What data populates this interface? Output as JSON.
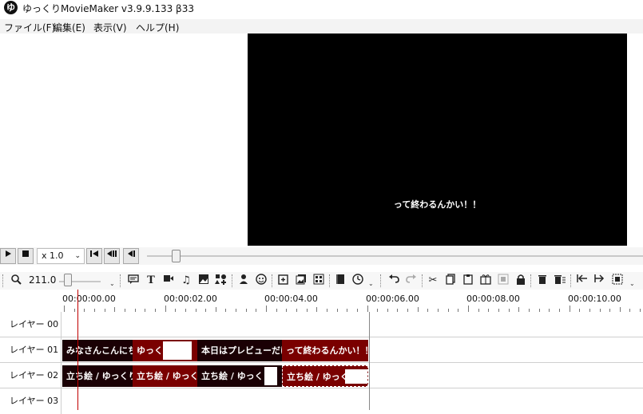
{
  "titlebar": {
    "icon_glyph": "ゆ",
    "title": "ゆっくりMovieMaker v3.9.9.133 β33"
  },
  "menu": [
    {
      "label": "ファイル(F)"
    },
    {
      "label": "編集(E)"
    },
    {
      "label": "表示(V)"
    },
    {
      "label": "ヘルプ(H)"
    }
  ],
  "preview": {
    "subtitle": "って終わるんかい！！"
  },
  "playback": {
    "speed": "x 1.0"
  },
  "timeline": {
    "zoom": "211.0",
    "ruler_labels": [
      "00:00:00.00",
      "00:00:02.00",
      "00:00:04.00",
      "00:00:06.00",
      "00:00:08.00",
      "00:00:10.00"
    ],
    "layers": [
      {
        "label": "レイヤー 00",
        "clips": []
      },
      {
        "label": "レイヤー 01",
        "clips": [
          {
            "text": "みなさんこんにち"
          },
          {
            "text": "ゆっくり"
          },
          {
            "text": "本日はプレビューだけ"
          },
          {
            "text": "って終わるんかい！！"
          }
        ]
      },
      {
        "label": "レイヤー 02",
        "clips": [
          {
            "text": "立ち絵 / ゆっくり"
          },
          {
            "text": "立ち絵 / ゆっく"
          },
          {
            "text": "立ち絵 / ゆっくり"
          },
          {
            "text": "立ち絵 / ゆっくり"
          }
        ]
      },
      {
        "label": "レイヤー 03",
        "clips": []
      }
    ]
  },
  "colors": {
    "clip_dark": "#1a0004",
    "clip_red": "#7a0000",
    "playhead": "#c00000"
  },
  "icons": [
    "zoom-icon",
    "comment-icon",
    "text-icon",
    "video-icon",
    "music-icon",
    "image-icon",
    "shape-icon",
    "character-icon",
    "face-icon",
    "add-scene-icon",
    "images-icon",
    "grid-icon",
    "book-icon",
    "clock-icon",
    "undo-icon",
    "redo-icon",
    "cut-icon",
    "copy-icon",
    "paste-icon",
    "gift-icon",
    "frame-icon",
    "lock-icon",
    "delete-icon",
    "delete-all-icon",
    "move-left-icon",
    "move-right-icon",
    "select-icon"
  ]
}
